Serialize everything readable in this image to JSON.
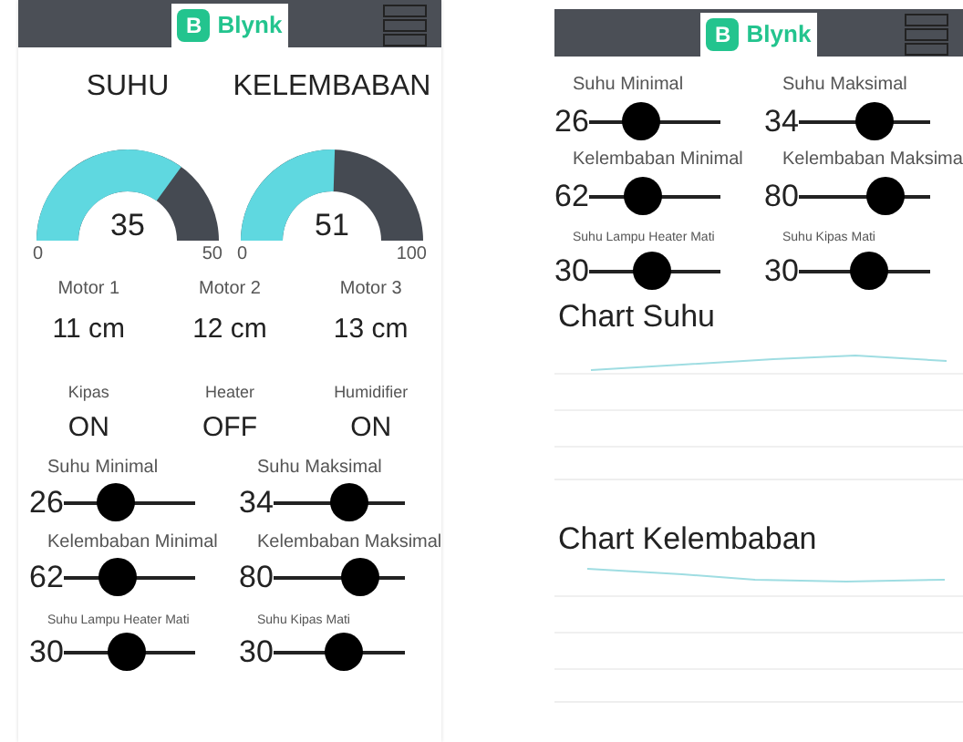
{
  "left_screen": {
    "header": {
      "logo_letter": "B",
      "logo_text": "Blynk"
    },
    "gauges": [
      {
        "title": "SUHU",
        "value": "35",
        "min": "0",
        "max": "50"
      },
      {
        "title": "KELEMBABAN",
        "value": "51",
        "min": "0",
        "max": "100"
      }
    ],
    "motors": [
      {
        "label": "Motor 1",
        "value": "11 cm"
      },
      {
        "label": "Motor 2",
        "value": "12 cm"
      },
      {
        "label": "Motor 3",
        "value": "13 cm"
      }
    ],
    "devices": [
      {
        "label": "Kipas",
        "value": "ON"
      },
      {
        "label": "Heater",
        "value": "OFF"
      },
      {
        "label": "Humidifier",
        "value": "ON"
      }
    ],
    "sliders": [
      {
        "kind": "regular",
        "label": "Suhu Minimal",
        "value": "26",
        "level": 0.35
      },
      {
        "kind": "regular",
        "label": "Suhu Maksimal",
        "value": "34",
        "level": 0.6
      },
      {
        "kind": "regular",
        "label": "Kelembaban Minimal",
        "value": "62",
        "level": 0.37
      },
      {
        "kind": "regular",
        "label": "Kelembaban Maksimal",
        "value": "80",
        "level": 0.72
      },
      {
        "kind": "small",
        "label": "Suhu Lampu Heater Mati",
        "value": "30",
        "level": 0.48
      },
      {
        "kind": "small",
        "label": "Suhu Kipas Mati",
        "value": "30",
        "level": 0.55
      }
    ]
  },
  "right_screen": {
    "header": {
      "logo_letter": "B",
      "logo_text": "Blynk"
    },
    "sliders": [
      {
        "kind": "regular",
        "label": "Suhu Minimal",
        "value": "26",
        "level": 0.35
      },
      {
        "kind": "regular",
        "label": "Suhu Maksimal",
        "value": "34",
        "level": 0.6
      },
      {
        "kind": "regular",
        "label": "Kelembaban Minimal",
        "value": "62",
        "level": 0.37
      },
      {
        "kind": "regular",
        "label": "Kelembaban Maksima",
        "value": "80",
        "level": 0.72
      },
      {
        "kind": "small",
        "label": "Suhu Lampu Heater Mati",
        "value": "30",
        "level": 0.48
      },
      {
        "kind": "small",
        "label": "Suhu Kipas Mati",
        "value": "30",
        "level": 0.55
      }
    ],
    "charts": [
      {
        "title": "Chart Suhu"
      },
      {
        "title": "Chart Kelembaban"
      }
    ]
  }
}
